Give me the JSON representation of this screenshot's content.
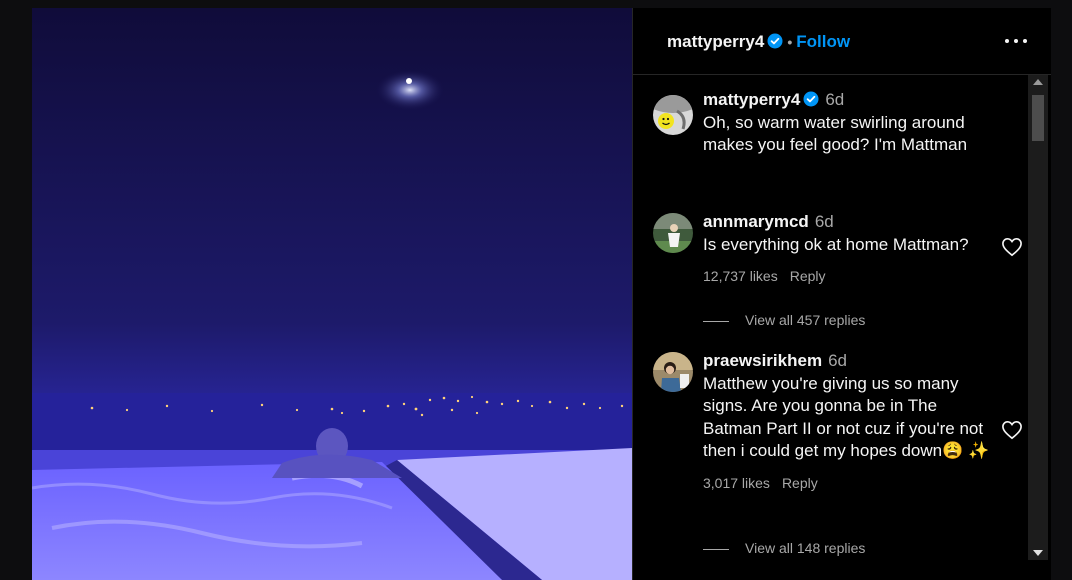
{
  "post": {
    "username": "mattyperry4",
    "follow_label": "Follow",
    "separator": "•",
    "caption": {
      "username": "mattyperry4",
      "time": "6d",
      "text": "Oh, so warm water swirling around makes you feel good? I'm Mattman"
    }
  },
  "comments": [
    {
      "username": "annmarymcd",
      "time": "6d",
      "text": "Is everything ok at home Mattman?",
      "likes": "12,737 likes",
      "reply_label": "Reply",
      "view_replies": "View all 457 replies"
    },
    {
      "username": "praewsirikhem",
      "time": "6d",
      "text": "Matthew you're giving us so many signs. Are you gonna be in The Batman Part II or not cuz if you're not then i could get my hopes down😩 ✨",
      "likes": "3,017 likes",
      "reply_label": "Reply",
      "view_replies": "View all 148 replies"
    }
  ],
  "icons": {
    "verified": "verified-badge-icon",
    "more": "more-options-icon",
    "heart": "heart-icon"
  },
  "colors": {
    "accent": "#0095f6",
    "panel_bg": "#000000",
    "secondary_text": "#a8a8a8"
  }
}
